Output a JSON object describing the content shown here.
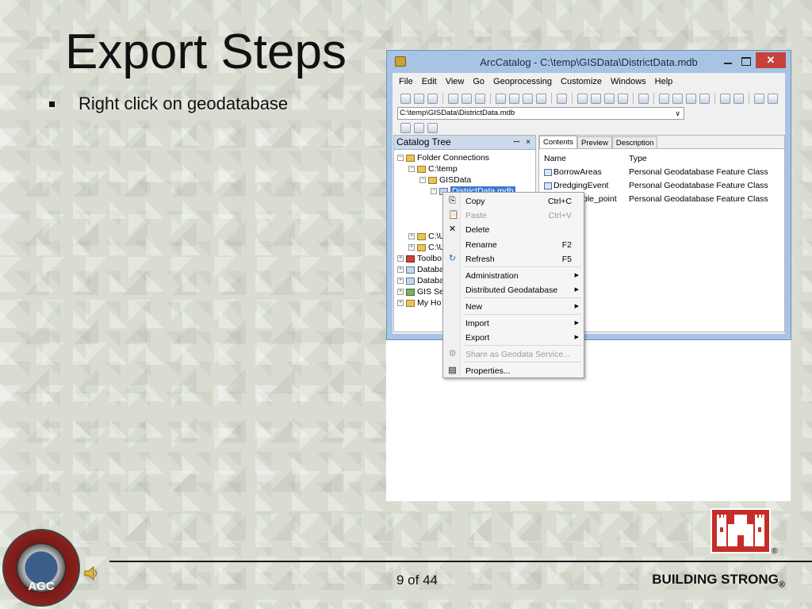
{
  "slide": {
    "title": "Export Steps",
    "bullet": "Right click on geodatabase",
    "page_number": "9 of 44",
    "footer_brand": "BUILDING STRONG",
    "footer_reg": "®",
    "seal_text": "AGC",
    "castle_reg": "®"
  },
  "window": {
    "title": "ArcCatalog - C:\\temp\\GISData\\DistrictData.mdb",
    "close_glyph": "✕",
    "menu": [
      "File",
      "Edit",
      "View",
      "Go",
      "Geoprocessing",
      "Customize",
      "Windows",
      "Help"
    ],
    "address": "C:\\temp\\GISData\\DistrictData.mdb",
    "address_chevron": "∨"
  },
  "catalog_tree": {
    "header": "Catalog Tree",
    "pin_glyph": "ꟷ",
    "close_glyph": "×",
    "items": [
      {
        "label": "Folder Connections",
        "pm": "−",
        "icon": "folder"
      },
      {
        "label": "C:\\temp",
        "pm": "−",
        "icon": "folder"
      },
      {
        "label": "GISData",
        "pm": "−",
        "icon": "folder"
      },
      {
        "label": "DistrictData.mdb",
        "pm": "−",
        "icon": "db"
      },
      {
        "label": "C:\\U",
        "pm": "+",
        "icon": "folder"
      },
      {
        "label": "C:\\U",
        "pm": "+",
        "icon": "folder"
      },
      {
        "label": "Toolbo",
        "pm": "+",
        "icon": "tool"
      },
      {
        "label": "Databa",
        "pm": "+",
        "icon": "db"
      },
      {
        "label": "Databa",
        "pm": "+",
        "icon": "db"
      },
      {
        "label": "GIS Ser",
        "pm": "+",
        "icon": "gis"
      },
      {
        "label": "My Ho",
        "pm": "+",
        "icon": "folder"
      }
    ]
  },
  "contents": {
    "tabs": [
      "Contents",
      "Preview",
      "Description"
    ],
    "columns": [
      "Name",
      "Type"
    ],
    "rows": [
      {
        "name": "BorrowAreas",
        "type": "Personal Geodatabase Feature Class"
      },
      {
        "name": "DredgingEvent",
        "type": "Personal Geodatabase Feature Class"
      },
      {
        "name": "ple_point",
        "type": "Personal Geodatabase Feature Class"
      }
    ]
  },
  "context_menu": {
    "items": [
      {
        "label": "Copy",
        "shortcut": "Ctrl+C",
        "icon": "copy-icon",
        "glyph": "⎘",
        "disabled": false,
        "submenu": false
      },
      {
        "label": "Paste",
        "shortcut": "Ctrl+V",
        "icon": "paste-icon",
        "glyph": "📋",
        "disabled": true,
        "submenu": false
      },
      {
        "label": "Delete",
        "shortcut": "",
        "icon": "delete-icon",
        "glyph": "✕",
        "disabled": false,
        "submenu": false
      },
      {
        "label": "Rename",
        "shortcut": "F2",
        "icon": "",
        "glyph": "",
        "disabled": false,
        "submenu": false
      },
      {
        "label": "Refresh",
        "shortcut": "F5",
        "icon": "refresh-icon",
        "glyph": "↻",
        "disabled": false,
        "submenu": false
      },
      {
        "label": "Administration",
        "shortcut": "",
        "icon": "",
        "glyph": "",
        "disabled": false,
        "submenu": true
      },
      {
        "label": "Distributed Geodatabase",
        "shortcut": "",
        "icon": "",
        "glyph": "",
        "disabled": false,
        "submenu": true
      },
      {
        "label": "New",
        "shortcut": "",
        "icon": "",
        "glyph": "",
        "disabled": false,
        "submenu": true
      },
      {
        "label": "Import",
        "shortcut": "",
        "icon": "",
        "glyph": "",
        "disabled": false,
        "submenu": true
      },
      {
        "label": "Export",
        "shortcut": "",
        "icon": "",
        "glyph": "",
        "disabled": false,
        "submenu": true
      },
      {
        "label": "Share as Geodata Service...",
        "shortcut": "",
        "icon": "share-icon",
        "glyph": "⚙",
        "disabled": true,
        "submenu": false
      },
      {
        "label": "Properties...",
        "shortcut": "",
        "icon": "properties-icon",
        "glyph": "▤",
        "disabled": false,
        "submenu": false
      }
    ],
    "submenu_arrow": "▶"
  },
  "colors": {
    "window_frame": "#a7c4e5",
    "close_button": "#c7423b",
    "selection": "#3a78d4",
    "castle_red": "#c62d28"
  }
}
